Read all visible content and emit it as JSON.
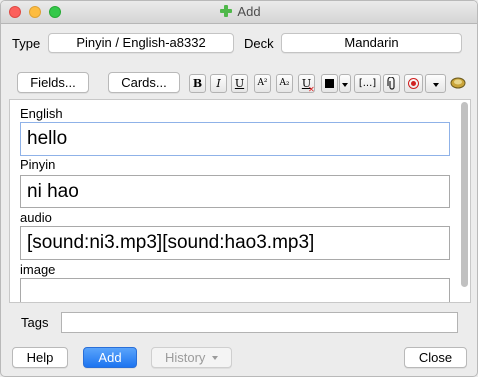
{
  "window": {
    "title": "Add"
  },
  "type_row": {
    "type_label": "Type",
    "type_value": "Pinyin / English-a8332",
    "deck_label": "Deck",
    "deck_value": "Mandarin"
  },
  "toolbar": {
    "fields_label": "Fields...",
    "cards_label": "Cards...",
    "bold": "B",
    "italic": "I",
    "underline": "U",
    "superscript": "A²",
    "subscript": "A₂",
    "clear_format": "U",
    "cloze": "[...]"
  },
  "fields": [
    {
      "name": "English",
      "value": "hello"
    },
    {
      "name": "Pinyin",
      "value": "ni hao"
    },
    {
      "name": "audio",
      "value": "[sound:ni3.mp3][sound:hao3.mp3]"
    },
    {
      "name": "image",
      "value": ""
    }
  ],
  "tags": {
    "label": "Tags",
    "value": ""
  },
  "buttons": {
    "help": "Help",
    "add": "Add",
    "history": "History",
    "close": "Close"
  },
  "colors": {
    "accent": "#2f83f7",
    "plus_icon": "#4fb84a"
  }
}
